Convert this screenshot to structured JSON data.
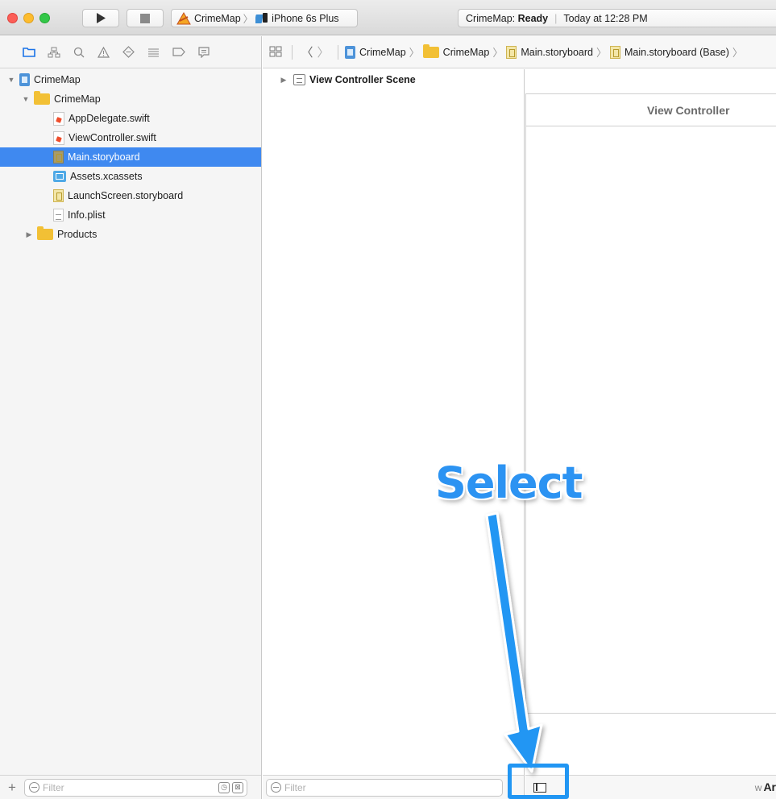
{
  "toolbar": {
    "scheme_name": "CrimeMap",
    "device_name": "iPhone 6s Plus",
    "activity_project": "CrimeMap:",
    "activity_status": "Ready",
    "activity_time": "Today at 12:28 PM"
  },
  "navigator": {
    "tabs": [
      "folder-icon",
      "hierarchy-icon",
      "search-icon",
      "warning-icon",
      "test-icon",
      "debug-icon",
      "breakpoint-icon",
      "report-icon"
    ],
    "items": [
      {
        "label": "CrimeMap",
        "type": "project",
        "expanded": true
      },
      {
        "label": "CrimeMap",
        "type": "folder",
        "expanded": true
      },
      {
        "label": "AppDelegate.swift",
        "type": "swift"
      },
      {
        "label": "ViewController.swift",
        "type": "swift"
      },
      {
        "label": "Main.storyboard",
        "type": "storyboard",
        "selected": true
      },
      {
        "label": "Assets.xcassets",
        "type": "assets"
      },
      {
        "label": "LaunchScreen.storyboard",
        "type": "storyboard"
      },
      {
        "label": "Info.plist",
        "type": "plist"
      },
      {
        "label": "Products",
        "type": "folder",
        "expanded": false
      }
    ],
    "filter_placeholder": "Filter"
  },
  "jumpbar": {
    "crumbs": [
      "CrimeMap",
      "CrimeMap",
      "Main.storyboard",
      "Main.storyboard (Base)"
    ]
  },
  "outline": {
    "scene_label": "View Controller Scene",
    "filter_placeholder": "Filter"
  },
  "canvas": {
    "vc_title": "View Controller",
    "size_class_prefix": "w",
    "size_class_value": "Ar"
  },
  "annotation": {
    "label": "Select",
    "color": "#2196f3"
  }
}
